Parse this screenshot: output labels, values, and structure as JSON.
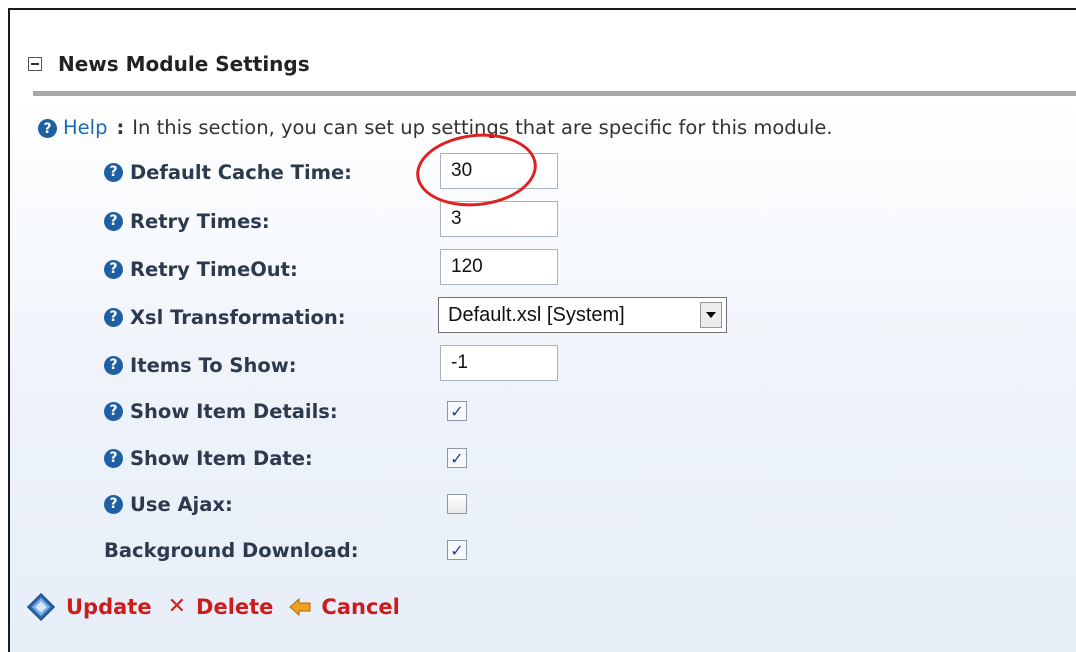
{
  "section": {
    "title": "News Module Settings"
  },
  "help": {
    "link": "Help",
    "colon": ":",
    "text": "In this section, you can set up settings that are specific for this module."
  },
  "fields": {
    "default_cache_time": {
      "label": "Default Cache Time:",
      "value": "30"
    },
    "retry_times": {
      "label": "Retry Times:",
      "value": "3"
    },
    "retry_timeout": {
      "label": "Retry TimeOut:",
      "value": "120"
    },
    "xsl_transformation": {
      "label": "Xsl Transformation:",
      "value": "Default.xsl [System]"
    },
    "items_to_show": {
      "label": "Items To Show:",
      "value": "-1"
    },
    "show_item_details": {
      "label": "Show Item Details:",
      "checked": true
    },
    "show_item_date": {
      "label": "Show Item Date:",
      "checked": true
    },
    "use_ajax": {
      "label": "Use Ajax:",
      "checked": false
    },
    "background_download": {
      "label": "Background Download:",
      "checked": true
    }
  },
  "actions": {
    "update": "Update",
    "delete": "Delete",
    "cancel": "Cancel"
  },
  "icons": {
    "help": "question-circle-icon",
    "collapse": "minus-box-icon",
    "update": "diamond-pencil-icon",
    "delete": "x-icon",
    "cancel": "left-arrow-icon"
  },
  "colors": {
    "accent": "#1f5fa3",
    "action_text": "#cc1c1c",
    "annotation": "#e02020"
  }
}
